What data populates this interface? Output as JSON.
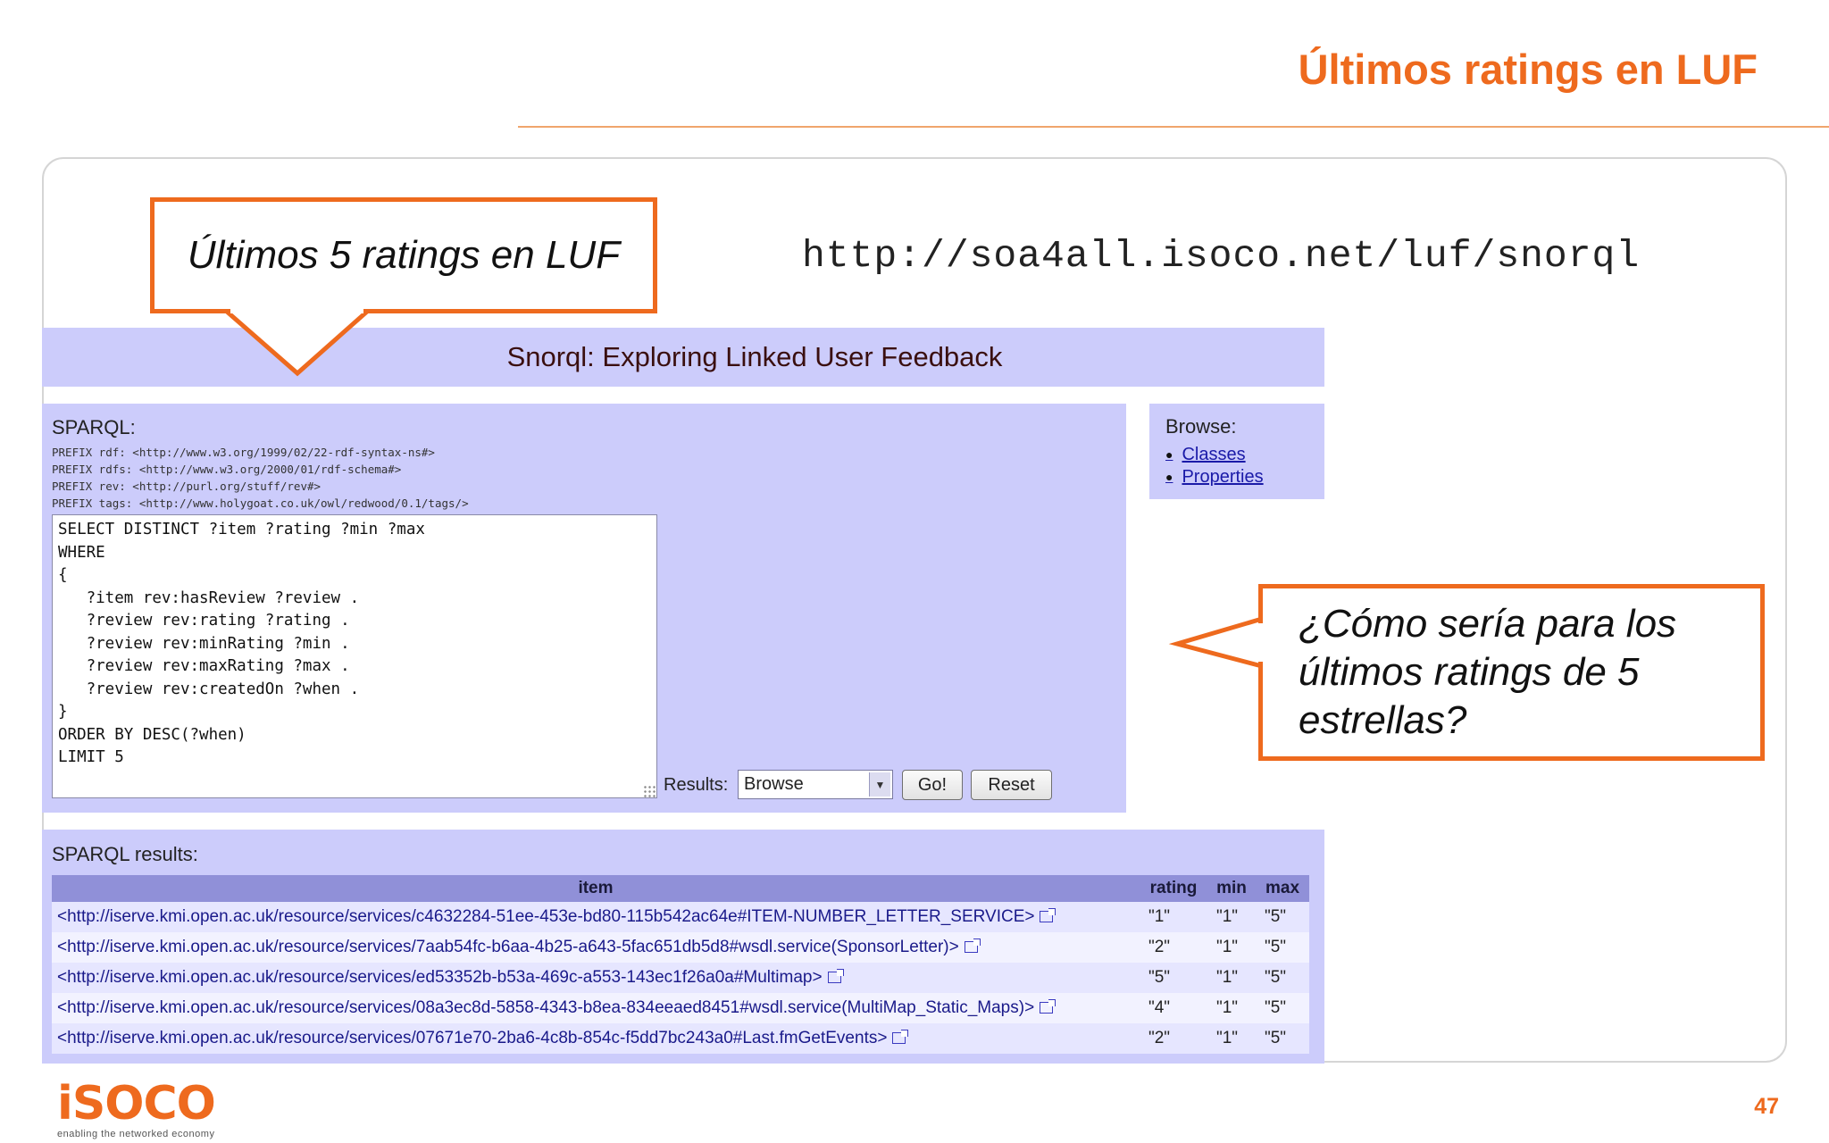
{
  "slide": {
    "title": "Últimos ratings en LUF",
    "page_number": "47",
    "logo_text": "iSOCO",
    "logo_tagline": "enabling the networked economy"
  },
  "callouts": {
    "top_left": "Últimos 5 ratings en LUF",
    "right": "¿Cómo sería para los últimos ratings de 5 estrellas?"
  },
  "url": "http://soa4all.isoco.net/luf/snorql",
  "snorql": {
    "header": "Snorql: Exploring Linked User Feedback",
    "sparql_label": "SPARQL:",
    "prefixes": [
      "PREFIX rdf: <http://www.w3.org/1999/02/22-rdf-syntax-ns#>",
      "PREFIX rdfs: <http://www.w3.org/2000/01/rdf-schema#>",
      "PREFIX rev: <http://purl.org/stuff/rev#>",
      "PREFIX tags: <http://www.holygoat.co.uk/owl/redwood/0.1/tags/>"
    ],
    "query": "SELECT DISTINCT ?item ?rating ?min ?max\nWHERE\n{\n   ?item rev:hasReview ?review .\n   ?review rev:rating ?rating .\n   ?review rev:minRating ?min .\n   ?review rev:maxRating ?max .\n   ?review rev:createdOn ?when .\n}\nORDER BY DESC(?when)\nLIMIT 5",
    "results_label": "Results:",
    "results_selected": "Browse",
    "go_label": "Go!",
    "reset_label": "Reset",
    "browse": {
      "label": "Browse:",
      "links": [
        "Classes",
        "Properties"
      ]
    },
    "results": {
      "title": "SPARQL results:",
      "columns": [
        "item",
        "rating",
        "min",
        "max"
      ],
      "rows": [
        {
          "item": "<http://iserve.kmi.open.ac.uk/resource/services/c4632284-51ee-453e-bd80-115b542ac64e#ITEM-NUMBER_LETTER_SERVICE>",
          "rating": "\"1\"",
          "min": "\"1\"",
          "max": "\"5\""
        },
        {
          "item": "<http://iserve.kmi.open.ac.uk/resource/services/7aab54fc-b6aa-4b25-a643-5fac651db5d8#wsdl.service(SponsorLetter)>",
          "rating": "\"2\"",
          "min": "\"1\"",
          "max": "\"5\""
        },
        {
          "item": "<http://iserve.kmi.open.ac.uk/resource/services/ed53352b-b53a-469c-a553-143ec1f26a0a#Multimap>",
          "rating": "\"5\"",
          "min": "\"1\"",
          "max": "\"5\""
        },
        {
          "item": "<http://iserve.kmi.open.ac.uk/resource/services/08a3ec8d-5858-4343-b8ea-834eeaed8451#wsdl.service(MultiMap_Static_Maps)>",
          "rating": "\"4\"",
          "min": "\"1\"",
          "max": "\"5\""
        },
        {
          "item": "<http://iserve.kmi.open.ac.uk/resource/services/07671e70-2ba6-4c8b-854c-f5dd7bc243a0#Last.fmGetEvents>",
          "rating": "\"2\"",
          "min": "\"1\"",
          "max": "\"5\""
        }
      ]
    }
  },
  "colors": {
    "accent": "#ee6a1e",
    "panel": "#ccccfb",
    "table_header": "#9090d8",
    "link": "#1a1aa8"
  },
  "icons": {
    "external_link": "external-link-icon",
    "dropdown": "chevron-down-icon"
  }
}
